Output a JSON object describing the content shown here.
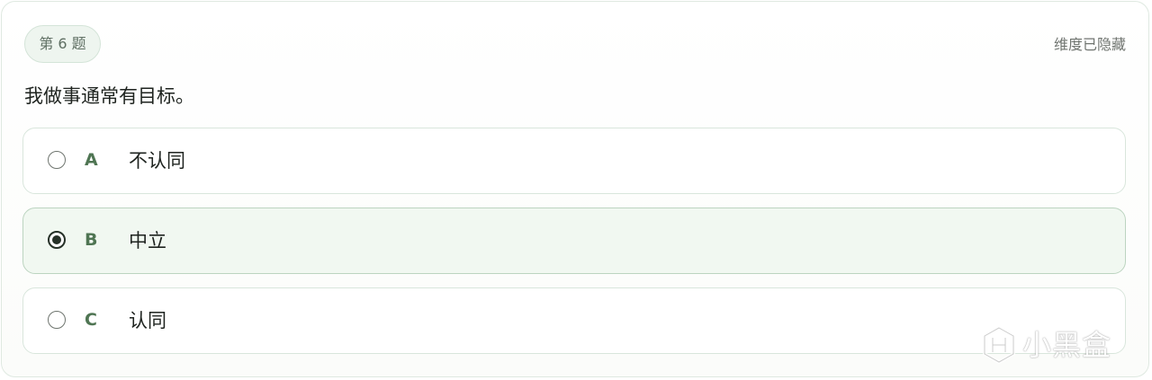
{
  "question": {
    "badge": "第 6 题",
    "dimension_status": "维度已隐藏",
    "text": "我做事通常有目标。"
  },
  "options": [
    {
      "letter": "A",
      "label": "不认同",
      "selected": false
    },
    {
      "letter": "B",
      "label": "中立",
      "selected": true
    },
    {
      "letter": "C",
      "label": "认同",
      "selected": false
    }
  ],
  "watermark": {
    "text": "小黑盒"
  },
  "colors": {
    "accent_green": "#4f7553",
    "selected_bg": "#f1f8f1",
    "badge_bg": "#eef5ef"
  }
}
